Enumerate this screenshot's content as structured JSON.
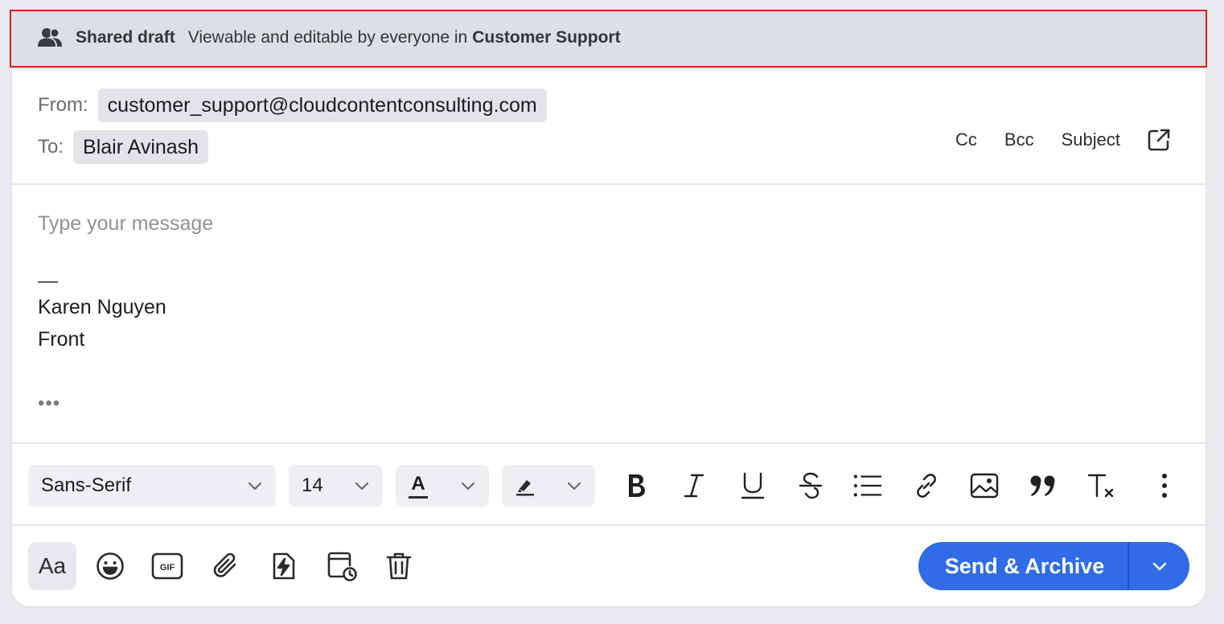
{
  "banner": {
    "title": "Shared draft",
    "description": "Viewable and editable by everyone in",
    "team": "Customer Support",
    "icon": "users-icon"
  },
  "header": {
    "from_label": "From:",
    "from_value": "customer_support@cloudcontentconsulting.com",
    "to_label": "To:",
    "to_value": "Blair Avinash",
    "actions": {
      "cc": "Cc",
      "bcc": "Bcc",
      "subject": "Subject"
    }
  },
  "body": {
    "placeholder": "Type your message",
    "signature_dash": "—",
    "signature_name": "Karen Nguyen",
    "signature_company": "Front",
    "more": "•••"
  },
  "format_toolbar": {
    "font_family": "Sans-Serif",
    "font_size": "14",
    "text_color_glyph": "A",
    "clear_format_glyph": "T"
  },
  "bottom_bar": {
    "format_toggle": "Aa",
    "send_label": "Send & Archive"
  },
  "colors": {
    "accent": "#2f6ce5",
    "banner_bg": "#dcdfe6",
    "banner_border": "#e01b1b"
  }
}
